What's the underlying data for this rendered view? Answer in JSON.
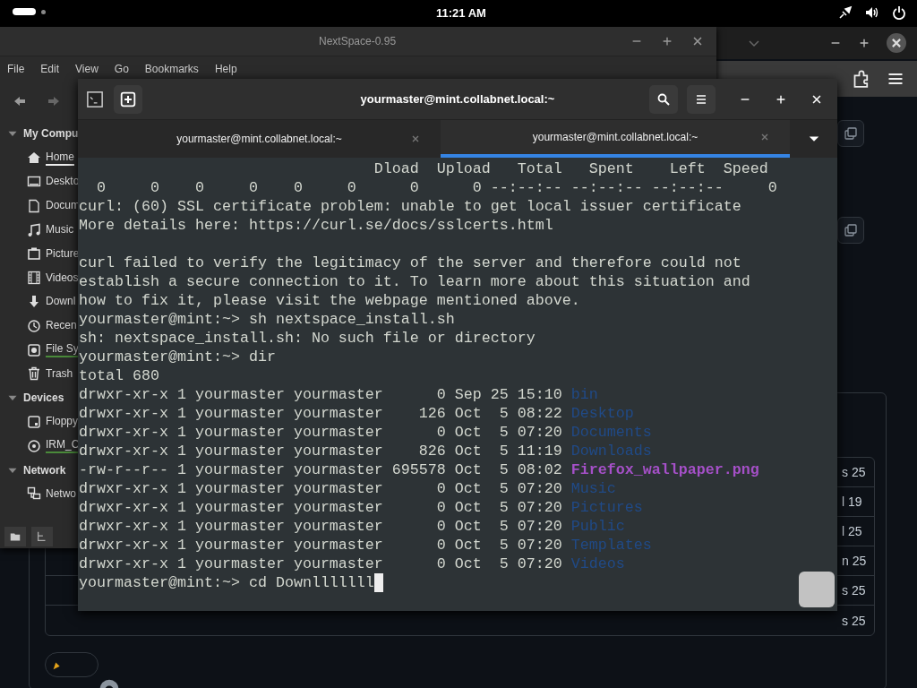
{
  "top_bar": {
    "time": "11:21 AM"
  },
  "browser": {
    "rows": [
      {
        "text": "s 25"
      },
      {
        "text": "l 19"
      },
      {
        "text": "l 25"
      },
      {
        "text": "n 25"
      },
      {
        "text": "s 25"
      },
      {
        "text": "s 25"
      }
    ]
  },
  "file_manager": {
    "title": "NextSpace-0.95",
    "menu": [
      "File",
      "Edit",
      "View",
      "Go",
      "Bookmarks",
      "Help"
    ],
    "sidebar": [
      {
        "label": "My Compu",
        "expanded": true,
        "children": [
          {
            "label": "Home",
            "kind": "home",
            "selected": true,
            "mounted": false
          },
          {
            "label": "Deskto",
            "kind": "desktop",
            "selected": false,
            "mounted": false
          },
          {
            "label": "Docum",
            "kind": "document",
            "selected": false,
            "mounted": false
          },
          {
            "label": "Music",
            "kind": "music",
            "selected": false,
            "mounted": false
          },
          {
            "label": "Picture",
            "kind": "picture",
            "selected": false,
            "mounted": false
          },
          {
            "label": "Videos",
            "kind": "video",
            "selected": false,
            "mounted": false
          },
          {
            "label": "Downl",
            "kind": "download",
            "selected": false,
            "mounted": false
          },
          {
            "label": "Recen",
            "kind": "recent",
            "selected": false,
            "mounted": false
          },
          {
            "label": "File Sy",
            "kind": "drive",
            "selected": false,
            "mounted": true
          },
          {
            "label": "Trash",
            "kind": "trash",
            "selected": false,
            "mounted": false
          }
        ]
      },
      {
        "label": "Devices",
        "expanded": true,
        "children": [
          {
            "label": "Floppy",
            "kind": "floppy",
            "selected": false,
            "mounted": false
          },
          {
            "label": "IRM_C",
            "kind": "disc",
            "selected": false,
            "mounted": true
          }
        ]
      },
      {
        "label": "Network",
        "expanded": true,
        "children": [
          {
            "label": "Netwo",
            "kind": "network",
            "selected": false,
            "mounted": false
          }
        ]
      }
    ]
  },
  "terminal": {
    "title": "yourmaster@mint.collabnet.local:~",
    "tabs": [
      {
        "label": "yourmaster@mint.collabnet.local:~",
        "selected": false
      },
      {
        "label": "yourmaster@mint.collabnet.local:~",
        "selected": true
      }
    ],
    "lines": [
      {
        "kind": "text",
        "text": "                                 Dload  Upload   Total   Spent    Left  Speed"
      },
      {
        "kind": "text",
        "text": "  0     0    0     0    0     0      0      0 --:--:-- --:--:-- --:--:--     0"
      },
      {
        "kind": "text",
        "text": "curl: (60) SSL certificate problem: unable to get local issuer certificate"
      },
      {
        "kind": "text",
        "text": "More details here: https://curl.se/docs/sslcerts.html"
      },
      {
        "kind": "blank"
      },
      {
        "kind": "text",
        "text": "curl failed to verify the legitimacy of the server and therefore could not"
      },
      {
        "kind": "text",
        "text": "establish a secure connection to it. To learn more about this situation and"
      },
      {
        "kind": "text",
        "text": "how to fix it, please visit the webpage mentioned above."
      },
      {
        "kind": "text",
        "text": "yourmaster@mint:~> sh nextspace_install.sh"
      },
      {
        "kind": "text",
        "text": "sh: nextspace_install.sh: No such file or directory"
      },
      {
        "kind": "text",
        "text": "yourmaster@mint:~> dir"
      },
      {
        "kind": "text",
        "text": "total 680"
      },
      {
        "kind": "dir_entry",
        "text": "drwxr-xr-x 1 yourmaster yourmaster      0 Sep 25 15:10",
        "name": "bin"
      },
      {
        "kind": "dir_entry",
        "text": "drwxr-xr-x 1 yourmaster yourmaster    126 Oct  5 08:22",
        "name": "Desktop"
      },
      {
        "kind": "dir_entry",
        "text": "drwxr-xr-x 1 yourmaster yourmaster      0 Oct  5 07:20",
        "name": "Documents"
      },
      {
        "kind": "dir_entry",
        "text": "drwxr-xr-x 1 yourmaster yourmaster    826 Oct  5 11:19",
        "name": "Downloads"
      },
      {
        "kind": "file_entry",
        "text": "-rw-r--r-- 1 yourmaster yourmaster 695578 Oct  5 08:02",
        "name": "Firefox_wallpaper.png"
      },
      {
        "kind": "dir_entry",
        "text": "drwxr-xr-x 1 yourmaster yourmaster      0 Oct  5 07:20",
        "name": "Music"
      },
      {
        "kind": "dir_entry",
        "text": "drwxr-xr-x 1 yourmaster yourmaster      0 Oct  5 07:20",
        "name": "Pictures"
      },
      {
        "kind": "dir_entry",
        "text": "drwxr-xr-x 1 yourmaster yourmaster      0 Oct  5 07:20",
        "name": "Public"
      },
      {
        "kind": "dir_entry",
        "text": "drwxr-xr-x 1 yourmaster yourmaster      0 Oct  5 07:20",
        "name": "Templates"
      },
      {
        "kind": "dir_entry",
        "text": "drwxr-xr-x 1 yourmaster yourmaster      0 Oct  5 07:20",
        "name": "Videos"
      },
      {
        "kind": "prompt",
        "text": "yourmaster@mint:~> cd Downlllllll",
        "cursor": true
      }
    ]
  }
}
